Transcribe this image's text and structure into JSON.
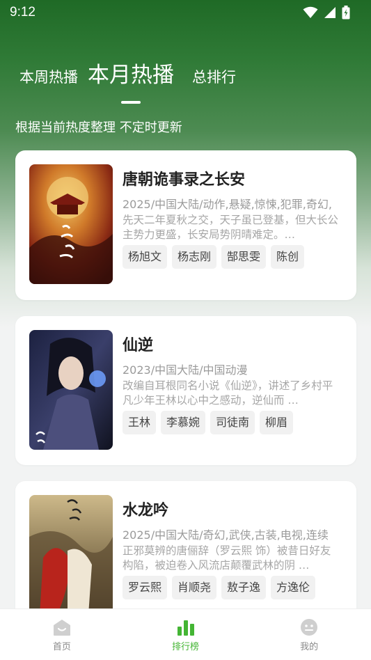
{
  "status": {
    "time": "9:12"
  },
  "tabs": [
    {
      "label": "本周热播"
    },
    {
      "label": "本月热播"
    },
    {
      "label": "总排行"
    }
  ],
  "subtitle": "根据当前热度整理 不定时更新",
  "cards": [
    {
      "title": "唐朝诡事录之长安",
      "meta": "2025/中国大陆/动作,悬疑,惊悚,犯罪,奇幻,",
      "desc": "先天二年夏秋之交，天子虽已登基，但大长公主势力更盛，长安局势阴晴难定。…",
      "actors": [
        "杨旭文",
        "杨志刚",
        "郜思雯",
        "陈创"
      ]
    },
    {
      "title": "仙逆",
      "meta": "2023/中国大陆/中国动漫",
      "desc": "改编自耳根同名小说《仙逆》，讲述了乡村平凡少年王林以心中之感动，逆仙而 …",
      "actors": [
        "王林",
        "李慕婉",
        "司徒南",
        "柳眉"
      ]
    },
    {
      "title": "水龙吟",
      "meta": "2025/中国大陆/奇幻,武侠,古装,电视,连续",
      "desc": "正邪莫辨的唐俪辞（罗云熙 饰）被昔日好友构陷，被迫卷入风流店颠覆武林的阴 …",
      "actors": [
        "罗云熙",
        "肖顺尧",
        "敖子逸",
        "方逸伦"
      ]
    }
  ],
  "nav": [
    {
      "label": "首页"
    },
    {
      "label": "排行榜"
    },
    {
      "label": "我的"
    }
  ],
  "colors": {
    "accent": "#44b534",
    "header": "#2f7a36"
  },
  "icons": [
    "wifi-icon",
    "signal-icon",
    "battery-icon",
    "home-icon",
    "rank-icon",
    "profile-icon"
  ]
}
